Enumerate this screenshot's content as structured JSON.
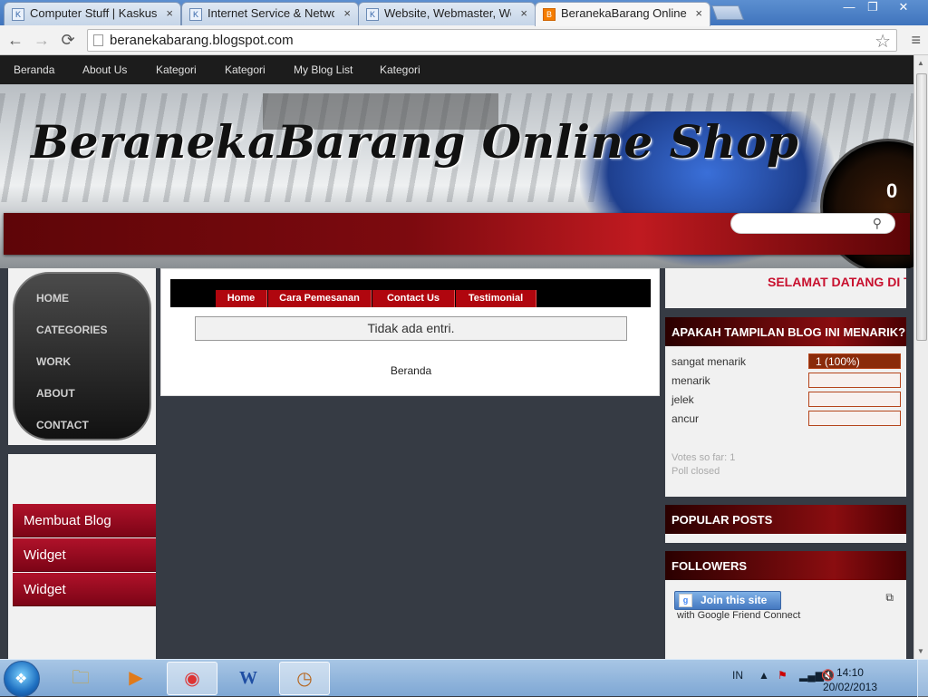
{
  "browser": {
    "tabs": [
      {
        "title": "Computer Stuff | Kaskus -",
        "active": false
      },
      {
        "title": "Internet Service & Networ",
        "active": false
      },
      {
        "title": "Website, Webmaster, Web",
        "active": false
      },
      {
        "title": "BeranekaBarang Online Sh",
        "active": true
      }
    ],
    "tab_close": "×",
    "url": "beranekabarang.blogspot.com",
    "window_buttons": {
      "minimize": "—",
      "maximize": "❐",
      "close": "✕"
    },
    "nav": {
      "back": "←",
      "forward": "→",
      "reload": "⟳",
      "star": "☆",
      "menu": "≡"
    }
  },
  "blog": {
    "nav_items": [
      "Beranda",
      "About Us",
      "Kategori",
      "Kategori",
      "My Blog List",
      "Kategori"
    ],
    "title": "BeranekaBarang Online Shop",
    "search_placeholder": "",
    "speedometer_digit": "0",
    "pill_menu": [
      "HOME",
      "CATEGORIES",
      "WORK",
      "ABOUT",
      "CONTACT"
    ],
    "left_buttons": [
      "Membuat Blog",
      "Widget",
      "Widget"
    ],
    "subnav": [
      "Home",
      "Cara Pemesanan",
      "Contact Us",
      "Testimonial"
    ],
    "no_entries": "Tidak ada entri.",
    "home_link": "Beranda",
    "marquee": "SELAMAT DATANG DI T",
    "poll": {
      "title": "APAKAH TAMPILAN BLOG INI MENARIK?",
      "options": [
        {
          "label": "sangat menarik",
          "pct_text": "1 (100%)",
          "fraction": 1.0
        },
        {
          "label": "menarik",
          "pct_text": "",
          "fraction": 0
        },
        {
          "label": "jelek",
          "pct_text": "",
          "fraction": 0
        },
        {
          "label": "ancur",
          "pct_text": "",
          "fraction": 0
        }
      ],
      "votes": "Votes so far: 1",
      "status": "Poll closed"
    },
    "popular_title": "POPULAR POSTS",
    "followers": {
      "title": "FOLLOWERS",
      "join_label": "Join this site",
      "sub": "with Google Friend Connect"
    }
  },
  "taskbar": {
    "start": "❖",
    "items": [
      {
        "icon": "folder-icon",
        "glyph": "🗀",
        "active": false
      },
      {
        "icon": "media-player-icon",
        "glyph": "▶",
        "active": false
      },
      {
        "icon": "chrome-icon",
        "glyph": "◉",
        "active": true
      },
      {
        "icon": "word-icon",
        "glyph": "W",
        "active": false
      },
      {
        "icon": "clock-app-icon",
        "glyph": "◷",
        "active": true
      }
    ],
    "lang": "IN",
    "time": "14:10",
    "date": "20/02/2013"
  },
  "colors": {
    "accent_red": "#b0060e",
    "nav_dark": "#1c1c1c",
    "page_bg": "#363b44"
  }
}
